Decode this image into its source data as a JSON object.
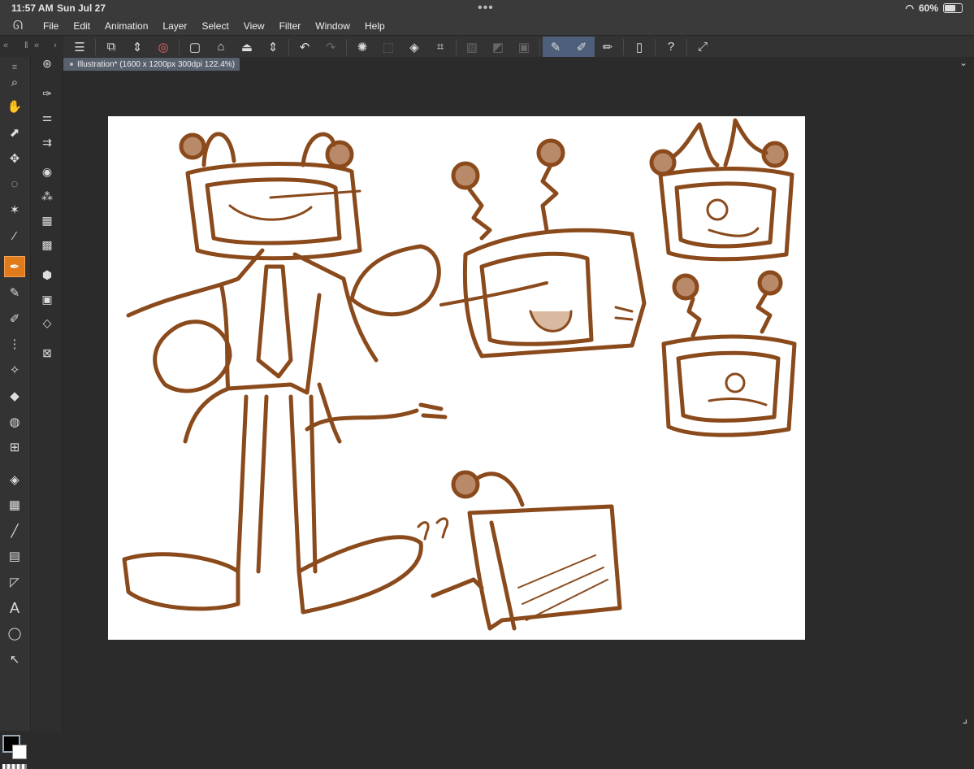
{
  "status": {
    "time": "11:57 AM",
    "date": "Sun Jul 27",
    "battery": "60%"
  },
  "menu": [
    "File",
    "Edit",
    "Animation",
    "Layer",
    "Select",
    "View",
    "Filter",
    "Window",
    "Help"
  ],
  "tab": {
    "label": "Illustration* (1600 x 1200px 300dpi 122.4%)"
  },
  "colors": {
    "main": "#000000",
    "sub": "#ffffff",
    "accent": "#e07b1c",
    "stroke": "#8a4a1c"
  },
  "commands": [
    "menu-icon",
    "new-canvas-icon",
    "expand-icon",
    "spiral-icon",
    "new-file-icon",
    "open-file-icon",
    "save-icon",
    "updown-icon",
    "undo-icon",
    "redo-icon",
    "loading-icon",
    "select-all-icon",
    "fill-icon",
    "crop-icon",
    "clear-icon",
    "invert-icon",
    "border-icon",
    "pen-active-icon",
    "brush-active-icon",
    "ruler-icon",
    "phone-icon",
    "help-icon",
    "expand-window-icon"
  ],
  "tools": [
    "zoom-icon",
    "hand-icon",
    "operation-icon",
    "move-icon",
    "lasso-icon",
    "magic-wand-icon",
    "eyedropper-icon",
    "pen-tool-icon",
    "pencil-icon",
    "marker-icon",
    "airbrush-icon",
    "decoration-icon",
    "eraser-icon",
    "blend-icon",
    "mesh-icon",
    "fill-tool-icon",
    "gradient-icon",
    "line-icon",
    "frame-icon",
    "ruler-tool-icon",
    "text-icon",
    "balloon-icon",
    "correct-line-icon"
  ],
  "subtools": [
    "navigator-icon",
    "brush-size-icon",
    "tool-property-icon",
    "sub-tool-icon",
    "color-wheel-icon",
    "color-set-icon",
    "intermediate-color-icon",
    "film-icon",
    "material-icon",
    "layer-property-icon",
    "layers-icon",
    "search-layer-icon"
  ]
}
